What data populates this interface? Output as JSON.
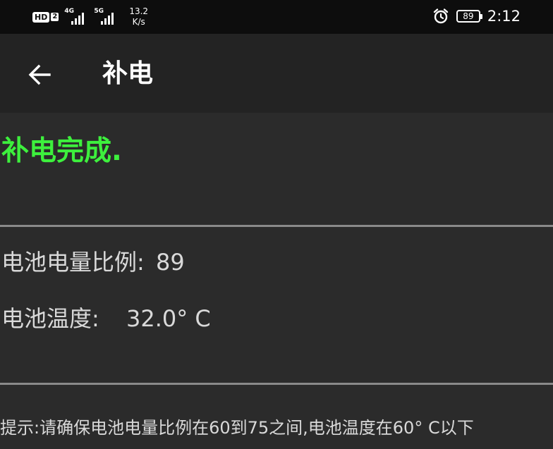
{
  "status_bar": {
    "hd_label": "HD",
    "sim_number": "2",
    "network_1": "4G",
    "network_2": "5G",
    "speed_value": "13.2",
    "speed_unit": "K/s",
    "battery_level": "89",
    "time": "2:12",
    "icons": [
      "alarm-icon",
      "battery-icon",
      "signal-icon"
    ]
  },
  "app_bar": {
    "back_icon": "arrow-left-icon",
    "title": "补电"
  },
  "status": {
    "result": "补电完成.",
    "color": "#3df03d"
  },
  "battery_info": {
    "level_label": "电池电量比例:",
    "level_value": "89",
    "temp_label": "电池温度:",
    "temp_value": "32.0° C"
  },
  "hint": {
    "text": "提示:请确保电池电量比例在60到75之间,电池温度在60° C以下"
  }
}
